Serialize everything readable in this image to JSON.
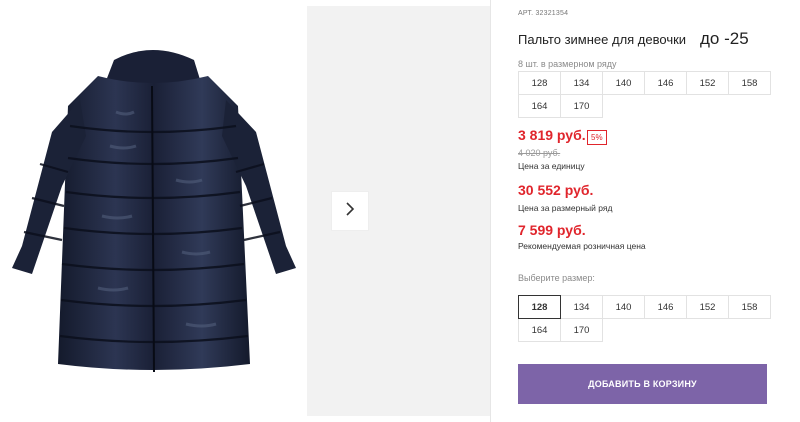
{
  "product": {
    "art_label": "АРТ.",
    "art_number": "32321354",
    "title": "Пальто зимнее для девочки",
    "temperature": "до -25",
    "pack_note": "8 шт. в размерном ряду",
    "pack_sizes": [
      "128",
      "134",
      "140",
      "146",
      "152",
      "158",
      "164",
      "170"
    ]
  },
  "pricing": {
    "unit_price": "3 819 руб.",
    "discount": "5%",
    "old_price": "4 020 руб.",
    "unit_label": "Цена за единицу",
    "row_price": "30 552 руб.",
    "row_label": "Цена за размерный ряд",
    "rrp_price": "7 599 руб.",
    "rrp_label": "Рекомендуемая розничная цена"
  },
  "size_picker": {
    "label": "Выберите размер:",
    "sizes": [
      "128",
      "134",
      "140",
      "146",
      "152",
      "158",
      "164",
      "170"
    ],
    "selected": "128"
  },
  "cart": {
    "add_label": "ДОБАВИТЬ В КОРЗИНУ"
  },
  "gallery": {
    "next_icon": "chevron-right-icon",
    "coat_color": "#1c2238",
    "accent_color": "#7d64a8",
    "price_color": "#e0252c"
  }
}
